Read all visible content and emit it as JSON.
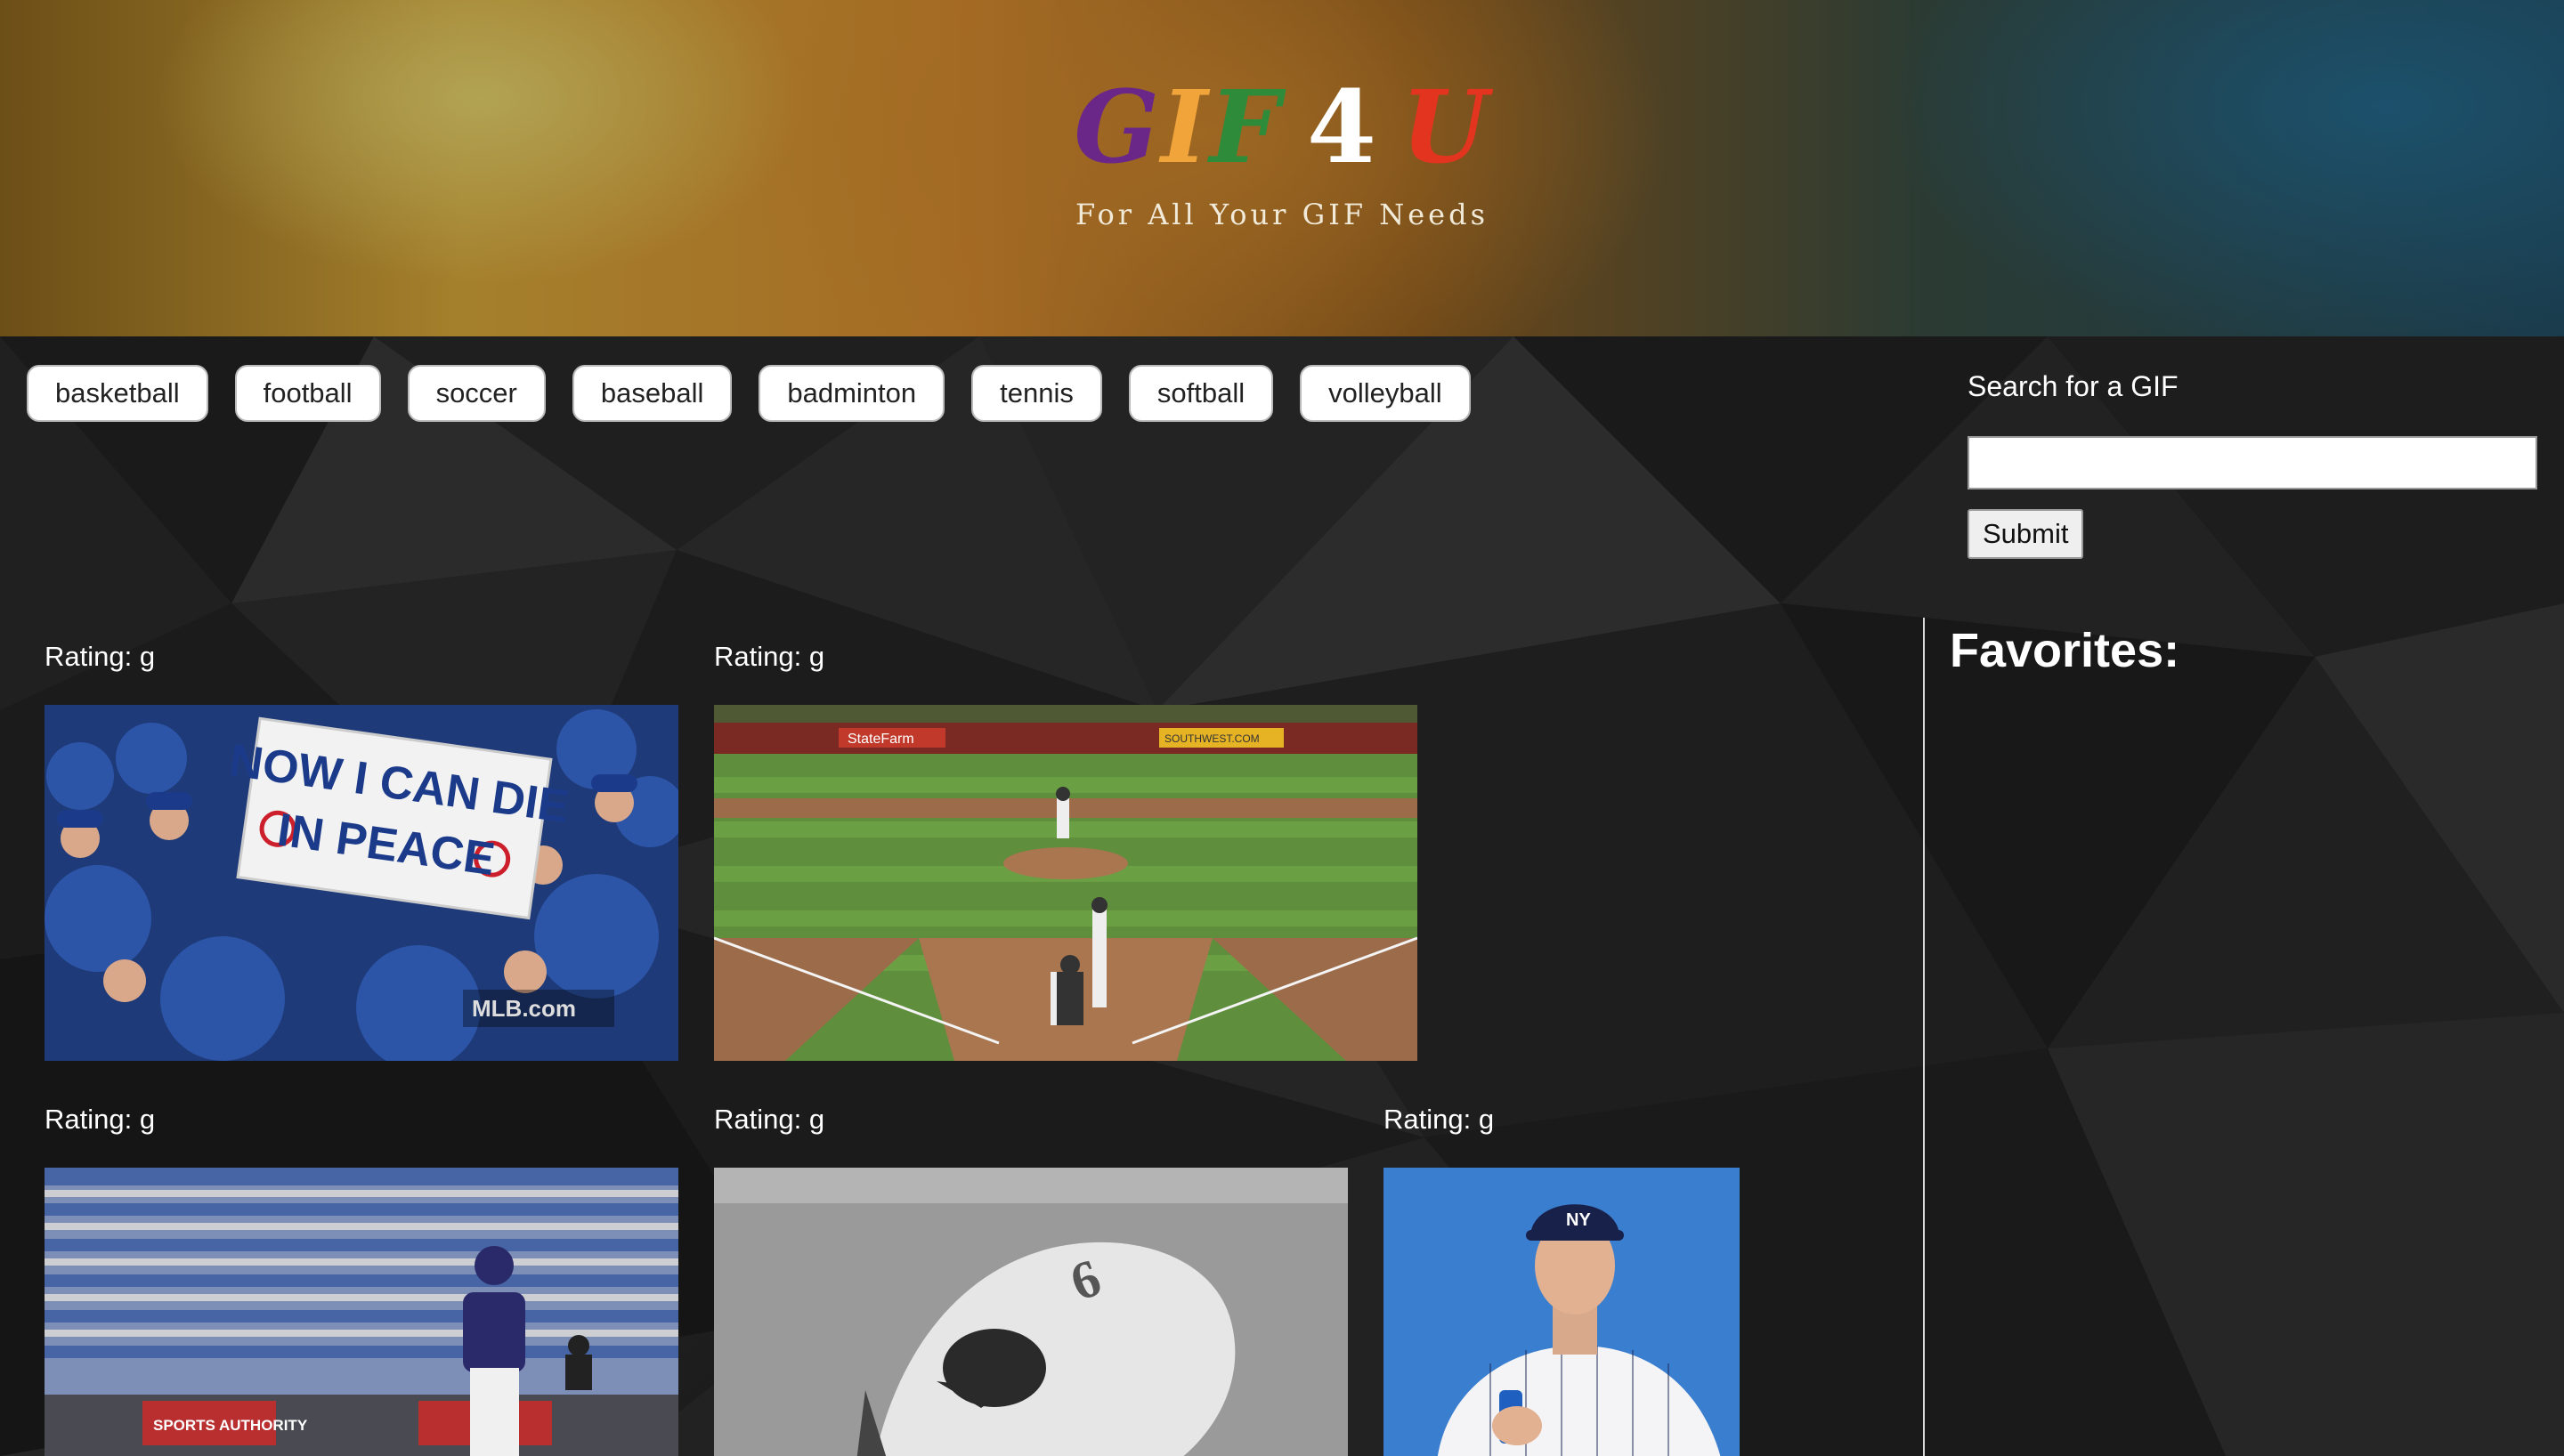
{
  "header": {
    "logo": {
      "letters": [
        {
          "text": "G",
          "color": "#6a2788"
        },
        {
          "text": "I",
          "color": "#f0a43a"
        },
        {
          "text": "F",
          "color": "#2e8b3a"
        },
        {
          "text": " ",
          "color": "#ffffff"
        },
        {
          "text": "4",
          "color": "#ffffff"
        },
        {
          "text": " ",
          "color": "#ffffff"
        },
        {
          "text": "U",
          "color": "#e3341f"
        }
      ]
    },
    "tagline": "For All Your GIF Needs"
  },
  "topics": [
    "basketball",
    "football",
    "soccer",
    "baseball",
    "badminton",
    "tennis",
    "softball",
    "volleyball"
  ],
  "search": {
    "label": "Search for a GIF",
    "value": "",
    "placeholder": "",
    "submit_label": "Submit"
  },
  "favorites": {
    "title": "Favorites:"
  },
  "gifs": [
    {
      "rating": "Rating: g",
      "sign_line1": "NOW I CAN DIE",
      "sign_line2": "IN PEACE",
      "watermark": "MLB.com"
    },
    {
      "rating": "Rating: g",
      "ad_text": "StateFarm",
      "ad_text2": "SOUTHWEST.COM"
    },
    {
      "rating": "Rating: g",
      "banner": "SPORTS AUTHORITY"
    },
    {
      "rating": "Rating: g",
      "jersey_number": "6"
    },
    {
      "rating": "Rating: g",
      "cap_logo": "NY"
    }
  ]
}
